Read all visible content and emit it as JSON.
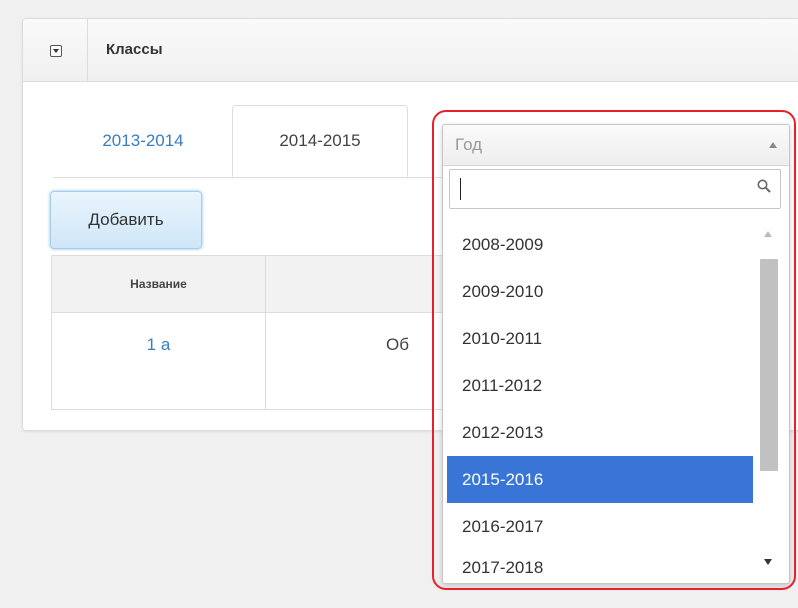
{
  "panel": {
    "title": "Классы"
  },
  "tabs": [
    {
      "label": "2013-2014",
      "active": false
    },
    {
      "label": "2014-2015",
      "active": true
    }
  ],
  "toolbar": {
    "add_label": "Добавить"
  },
  "table": {
    "columns": [
      "Название",
      ""
    ],
    "rows": [
      {
        "name": "1 а",
        "description": "Об"
      }
    ]
  },
  "dropdown": {
    "placeholder": "Год",
    "search_value": "",
    "search_icon": "search-icon",
    "options": [
      {
        "label": "2008-2009",
        "selected": false
      },
      {
        "label": "2009-2010",
        "selected": false
      },
      {
        "label": "2010-2011",
        "selected": false
      },
      {
        "label": "2011-2012",
        "selected": false
      },
      {
        "label": "2012-2013",
        "selected": false
      },
      {
        "label": "2015-2016",
        "selected": true
      },
      {
        "label": "2016-2017",
        "selected": false
      },
      {
        "label": "2017-2018",
        "selected": false
      }
    ]
  },
  "colors": {
    "selected": "#3875d7",
    "link": "#3a7dc0",
    "highlight": "#e8202a"
  }
}
